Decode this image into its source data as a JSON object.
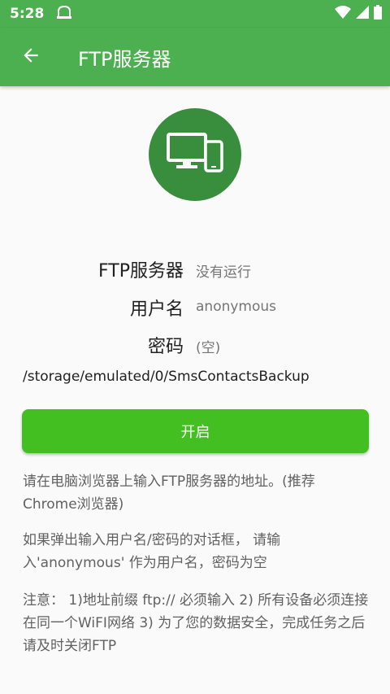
{
  "status_bar": {
    "time": "5:28"
  },
  "app_bar": {
    "title": "FTP服务器"
  },
  "info": {
    "server_label": "FTP服务器",
    "server_status": "没有运行",
    "username_label": "用户名",
    "username_value": "anonymous",
    "password_label": "密码",
    "password_value": "(空)"
  },
  "path": "/storage/emulated/0/SmsContactsBackup",
  "start_button": "开启",
  "instructions": {
    "p1": "请在电脑浏览器上输入FTP服务器的地址。(推荐Chrome浏览器)",
    "p2": "如果弹出输入用户名/密码的对话框， 请输入'anonymous' 作为用户名，密码为空",
    "p3": "注意： 1)地址前缀 ftp:// 必须输入 2) 所有设备必须连接在同一个WiFI网络 3) 为了您的数据安全，完成任务之后请及时关闭FTP"
  }
}
